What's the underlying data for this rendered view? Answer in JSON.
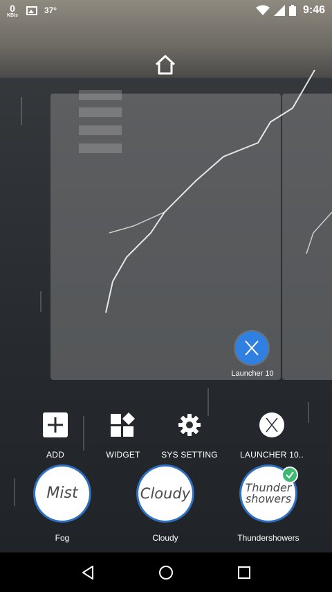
{
  "status_bar": {
    "net_speed": "0",
    "net_unit": "KB/s",
    "temperature": "37°",
    "time": "9:46",
    "icons": [
      "image-icon",
      "wifi-icon",
      "cell-signal-icon",
      "battery-icon"
    ]
  },
  "home": {
    "icon": "home-icon"
  },
  "preview": {
    "app_label": "Launcher 10",
    "app_icon": "launcher-x-icon",
    "accent": "#2f80e0"
  },
  "menu": [
    {
      "label": "ADD",
      "icon": "plus-icon"
    },
    {
      "label": "WIDGET",
      "icon": "widget-icon"
    },
    {
      "label": "SYS SETTING",
      "icon": "gear-icon"
    },
    {
      "label": "LAUNCHER 10..",
      "icon": "launcher-x-icon"
    }
  ],
  "weather": [
    {
      "text": "Mist",
      "label": "Fog",
      "selected": false
    },
    {
      "text": "Cloudy",
      "label": "Cloudy",
      "selected": false
    },
    {
      "text": "Thunder showers",
      "label": "Thundershowers",
      "selected": true
    }
  ],
  "colors": {
    "ring": "#2e6fc0",
    "check": "#3fb872"
  },
  "nav": {
    "back": "back-icon",
    "home": "home-circle-icon",
    "recents": "recents-icon"
  }
}
